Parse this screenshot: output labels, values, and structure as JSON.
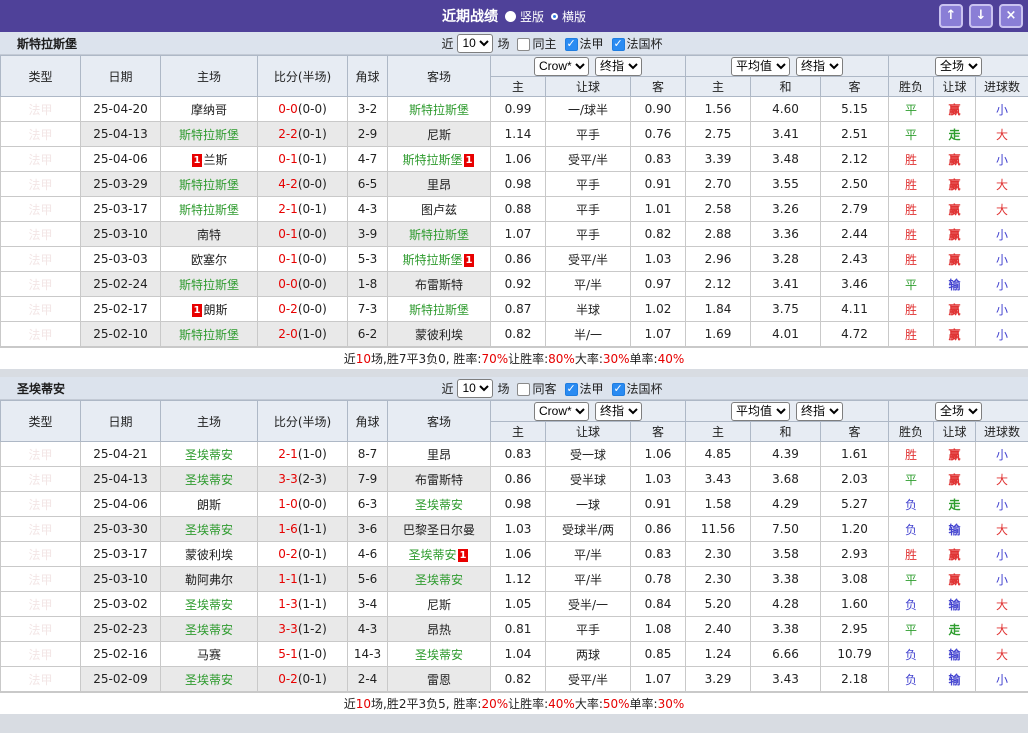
{
  "titlebar": {
    "title": "近期战绩",
    "radios": [
      {
        "label": "竖版",
        "selected": true
      },
      {
        "label": "横版",
        "selected": false
      }
    ],
    "buttons": {
      "up": "↑",
      "down": "↓",
      "close": "×"
    }
  },
  "colors": {
    "titlebar_purple": "#4f4199",
    "league_cell_bg": "#5e3c3c",
    "focus_team_green": "#2e9b2e",
    "score_red": "#e60000",
    "win_red": "#e03333",
    "draw_green": "#2f9e2f",
    "loss_blue": "#4444d0",
    "crow_column_bg": "#fdf6ee",
    "average_column_bg": "#eaf4fa",
    "checkbox_blue": "#2a8bf2"
  },
  "table_header": {
    "main_columns": [
      "类型",
      "日期",
      "主场",
      "比分(半场)",
      "角球",
      "客场"
    ],
    "groups": [
      {
        "selects": [
          "Crow*",
          "终指"
        ],
        "subcols": [
          "主",
          "让球",
          "客"
        ]
      },
      {
        "selects": [
          "平均值",
          "终指"
        ],
        "subcols": [
          "主",
          "和",
          "客"
        ]
      },
      {
        "selects": [
          "全场"
        ],
        "subcols": [
          "胜负",
          "让球",
          "进球数"
        ]
      }
    ]
  },
  "sections": [
    {
      "team": "斯特拉斯堡",
      "filter": {
        "prefix": "近",
        "count": "10",
        "suffix": "场",
        "checkboxes": [
          {
            "label": "同主",
            "checked": false
          },
          {
            "label": "法甲",
            "checked": true
          },
          {
            "label": "法国杯",
            "checked": true
          }
        ]
      },
      "rows": [
        {
          "league": "法甲",
          "date": "25-04-20",
          "home": "摩纳哥",
          "home_focus": false,
          "home_card": "",
          "score": "0-0",
          "half": "(0-0)",
          "corners": "3-2",
          "away": "斯特拉斯堡",
          "away_focus": true,
          "away_card": "",
          "crow": [
            "0.99",
            "一/球半",
            "0.90"
          ],
          "avg": [
            "1.56",
            "4.60",
            "5.15"
          ],
          "results": [
            [
              "平",
              "green"
            ],
            [
              "赢",
              "red"
            ],
            [
              "小",
              "blue"
            ]
          ]
        },
        {
          "league": "法甲",
          "date": "25-04-13",
          "home": "斯特拉斯堡",
          "home_focus": true,
          "home_card": "",
          "score": "2-2",
          "half": "(0-1)",
          "corners": "2-9",
          "away": "尼斯",
          "away_focus": false,
          "away_card": "",
          "crow": [
            "1.14",
            "平手",
            "0.76"
          ],
          "avg": [
            "2.75",
            "3.41",
            "2.51"
          ],
          "results": [
            [
              "平",
              "green"
            ],
            [
              "走",
              "green"
            ],
            [
              "大",
              "red"
            ]
          ]
        },
        {
          "league": "法甲",
          "date": "25-04-06",
          "home": "兰斯",
          "home_focus": false,
          "home_card": "1",
          "score": "0-1",
          "half": "(0-1)",
          "corners": "4-7",
          "away": "斯特拉斯堡",
          "away_focus": true,
          "away_card": "1",
          "crow": [
            "1.06",
            "受平/半",
            "0.83"
          ],
          "avg": [
            "3.39",
            "3.48",
            "2.12"
          ],
          "results": [
            [
              "胜",
              "red"
            ],
            [
              "赢",
              "red"
            ],
            [
              "小",
              "blue"
            ]
          ]
        },
        {
          "league": "法甲",
          "date": "25-03-29",
          "home": "斯特拉斯堡",
          "home_focus": true,
          "home_card": "",
          "score": "4-2",
          "half": "(0-0)",
          "corners": "6-5",
          "away": "里昂",
          "away_focus": false,
          "away_card": "",
          "crow": [
            "0.98",
            "平手",
            "0.91"
          ],
          "avg": [
            "2.70",
            "3.55",
            "2.50"
          ],
          "results": [
            [
              "胜",
              "red"
            ],
            [
              "赢",
              "red"
            ],
            [
              "大",
              "red"
            ]
          ]
        },
        {
          "league": "法甲",
          "date": "25-03-17",
          "home": "斯特拉斯堡",
          "home_focus": true,
          "home_card": "",
          "score": "2-1",
          "half": "(0-1)",
          "corners": "4-3",
          "away": "图卢兹",
          "away_focus": false,
          "away_card": "",
          "crow": [
            "0.88",
            "平手",
            "1.01"
          ],
          "avg": [
            "2.58",
            "3.26",
            "2.79"
          ],
          "results": [
            [
              "胜",
              "red"
            ],
            [
              "赢",
              "red"
            ],
            [
              "大",
              "red"
            ]
          ]
        },
        {
          "league": "法甲",
          "date": "25-03-10",
          "home": "南特",
          "home_focus": false,
          "home_card": "",
          "score": "0-1",
          "half": "(0-0)",
          "corners": "3-9",
          "away": "斯特拉斯堡",
          "away_focus": true,
          "away_card": "",
          "crow": [
            "1.07",
            "平手",
            "0.82"
          ],
          "avg": [
            "2.88",
            "3.36",
            "2.44"
          ],
          "results": [
            [
              "胜",
              "red"
            ],
            [
              "赢",
              "red"
            ],
            [
              "小",
              "blue"
            ]
          ]
        },
        {
          "league": "法甲",
          "date": "25-03-03",
          "home": "欧塞尔",
          "home_focus": false,
          "home_card": "",
          "score": "0-1",
          "half": "(0-0)",
          "corners": "5-3",
          "away": "斯特拉斯堡",
          "away_focus": true,
          "away_card": "1",
          "crow": [
            "0.86",
            "受平/半",
            "1.03"
          ],
          "avg": [
            "2.96",
            "3.28",
            "2.43"
          ],
          "results": [
            [
              "胜",
              "red"
            ],
            [
              "赢",
              "red"
            ],
            [
              "小",
              "blue"
            ]
          ]
        },
        {
          "league": "法甲",
          "date": "25-02-24",
          "home": "斯特拉斯堡",
          "home_focus": true,
          "home_card": "",
          "score": "0-0",
          "half": "(0-0)",
          "corners": "1-8",
          "away": "布雷斯特",
          "away_focus": false,
          "away_card": "",
          "crow": [
            "0.92",
            "平/半",
            "0.97"
          ],
          "avg": [
            "2.12",
            "3.41",
            "3.46"
          ],
          "results": [
            [
              "平",
              "green"
            ],
            [
              "输",
              "blue"
            ],
            [
              "小",
              "blue"
            ]
          ]
        },
        {
          "league": "法甲",
          "date": "25-02-17",
          "home": "朗斯",
          "home_focus": false,
          "home_card": "1",
          "score": "0-2",
          "half": "(0-0)",
          "corners": "7-3",
          "away": "斯特拉斯堡",
          "away_focus": true,
          "away_card": "",
          "crow": [
            "0.87",
            "半球",
            "1.02"
          ],
          "avg": [
            "1.84",
            "3.75",
            "4.11"
          ],
          "results": [
            [
              "胜",
              "red"
            ],
            [
              "赢",
              "red"
            ],
            [
              "小",
              "blue"
            ]
          ]
        },
        {
          "league": "法甲",
          "date": "25-02-10",
          "home": "斯特拉斯堡",
          "home_focus": true,
          "home_card": "",
          "score": "2-0",
          "half": "(1-0)",
          "corners": "6-2",
          "away": "蒙彼利埃",
          "away_focus": false,
          "away_card": "",
          "crow": [
            "0.82",
            "半/一",
            "1.07"
          ],
          "avg": [
            "1.69",
            "4.01",
            "4.72"
          ],
          "results": [
            [
              "胜",
              "red"
            ],
            [
              "赢",
              "red"
            ],
            [
              "小",
              "blue"
            ]
          ]
        }
      ],
      "summary": {
        "segments": [
          [
            "近",
            "dark"
          ],
          [
            "10",
            "red"
          ],
          [
            "场,胜7平3负0, 胜率:",
            "dark"
          ],
          [
            "70%",
            "red"
          ],
          [
            " 让胜率:",
            "dark"
          ],
          [
            "80%",
            "red"
          ],
          [
            " 大率:",
            "dark"
          ],
          [
            "30%",
            "red"
          ],
          [
            " 单率:",
            "dark"
          ],
          [
            "40%",
            "red"
          ]
        ]
      }
    },
    {
      "team": "圣埃蒂安",
      "filter": {
        "prefix": "近",
        "count": "10",
        "suffix": "场",
        "checkboxes": [
          {
            "label": "同客",
            "checked": false
          },
          {
            "label": "法甲",
            "checked": true
          },
          {
            "label": "法国杯",
            "checked": true
          }
        ]
      },
      "rows": [
        {
          "league": "法甲",
          "date": "25-04-21",
          "home": "圣埃蒂安",
          "home_focus": true,
          "home_card": "",
          "score": "2-1",
          "half": "(1-0)",
          "corners": "8-7",
          "away": "里昂",
          "away_focus": false,
          "away_card": "",
          "crow": [
            "0.83",
            "受一球",
            "1.06"
          ],
          "avg": [
            "4.85",
            "4.39",
            "1.61"
          ],
          "results": [
            [
              "胜",
              "red"
            ],
            [
              "赢",
              "red"
            ],
            [
              "小",
              "blue"
            ]
          ]
        },
        {
          "league": "法甲",
          "date": "25-04-13",
          "home": "圣埃蒂安",
          "home_focus": true,
          "home_card": "",
          "score": "3-3",
          "half": "(2-3)",
          "corners": "7-9",
          "away": "布雷斯特",
          "away_focus": false,
          "away_card": "",
          "crow": [
            "0.86",
            "受半球",
            "1.03"
          ],
          "avg": [
            "3.43",
            "3.68",
            "2.03"
          ],
          "results": [
            [
              "平",
              "green"
            ],
            [
              "赢",
              "red"
            ],
            [
              "大",
              "red"
            ]
          ]
        },
        {
          "league": "法甲",
          "date": "25-04-06",
          "home": "朗斯",
          "home_focus": false,
          "home_card": "",
          "score": "1-0",
          "half": "(0-0)",
          "corners": "6-3",
          "away": "圣埃蒂安",
          "away_focus": true,
          "away_card": "",
          "crow": [
            "0.98",
            "一球",
            "0.91"
          ],
          "avg": [
            "1.58",
            "4.29",
            "5.27"
          ],
          "results": [
            [
              "负",
              "blue"
            ],
            [
              "走",
              "green"
            ],
            [
              "小",
              "blue"
            ]
          ]
        },
        {
          "league": "法甲",
          "date": "25-03-30",
          "home": "圣埃蒂安",
          "home_focus": true,
          "home_card": "",
          "score": "1-6",
          "half": "(1-1)",
          "corners": "3-6",
          "away": "巴黎圣日尔曼",
          "away_focus": false,
          "away_card": "",
          "crow": [
            "1.03",
            "受球半/两",
            "0.86"
          ],
          "avg": [
            "11.56",
            "7.50",
            "1.20"
          ],
          "results": [
            [
              "负",
              "blue"
            ],
            [
              "输",
              "blue"
            ],
            [
              "大",
              "red"
            ]
          ]
        },
        {
          "league": "法甲",
          "date": "25-03-17",
          "home": "蒙彼利埃",
          "home_focus": false,
          "home_card": "",
          "score": "0-2",
          "half": "(0-1)",
          "corners": "4-6",
          "away": "圣埃蒂安",
          "away_focus": true,
          "away_card": "1",
          "crow": [
            "1.06",
            "平/半",
            "0.83"
          ],
          "avg": [
            "2.30",
            "3.58",
            "2.93"
          ],
          "results": [
            [
              "胜",
              "red"
            ],
            [
              "赢",
              "red"
            ],
            [
              "小",
              "blue"
            ]
          ]
        },
        {
          "league": "法甲",
          "date": "25-03-10",
          "home": "勒阿弗尔",
          "home_focus": false,
          "home_card": "",
          "score": "1-1",
          "half": "(1-1)",
          "corners": "5-6",
          "away": "圣埃蒂安",
          "away_focus": true,
          "away_card": "",
          "crow": [
            "1.12",
            "平/半",
            "0.78"
          ],
          "avg": [
            "2.30",
            "3.38",
            "3.08"
          ],
          "results": [
            [
              "平",
              "green"
            ],
            [
              "赢",
              "red"
            ],
            [
              "小",
              "blue"
            ]
          ]
        },
        {
          "league": "法甲",
          "date": "25-03-02",
          "home": "圣埃蒂安",
          "home_focus": true,
          "home_card": "",
          "score": "1-3",
          "half": "(1-1)",
          "corners": "3-4",
          "away": "尼斯",
          "away_focus": false,
          "away_card": "",
          "crow": [
            "1.05",
            "受半/一",
            "0.84"
          ],
          "avg": [
            "5.20",
            "4.28",
            "1.60"
          ],
          "results": [
            [
              "负",
              "blue"
            ],
            [
              "输",
              "blue"
            ],
            [
              "大",
              "red"
            ]
          ]
        },
        {
          "league": "法甲",
          "date": "25-02-23",
          "home": "圣埃蒂安",
          "home_focus": true,
          "home_card": "",
          "score": "3-3",
          "half": "(1-2)",
          "corners": "4-3",
          "away": "昂热",
          "away_focus": false,
          "away_card": "",
          "crow": [
            "0.81",
            "平手",
            "1.08"
          ],
          "avg": [
            "2.40",
            "3.38",
            "2.95"
          ],
          "results": [
            [
              "平",
              "green"
            ],
            [
              "走",
              "green"
            ],
            [
              "大",
              "red"
            ]
          ]
        },
        {
          "league": "法甲",
          "date": "25-02-16",
          "home": "马赛",
          "home_focus": false,
          "home_card": "",
          "score": "5-1",
          "half": "(1-0)",
          "corners": "14-3",
          "away": "圣埃蒂安",
          "away_focus": true,
          "away_card": "",
          "crow": [
            "1.04",
            "两球",
            "0.85"
          ],
          "avg": [
            "1.24",
            "6.66",
            "10.79"
          ],
          "results": [
            [
              "负",
              "blue"
            ],
            [
              "输",
              "blue"
            ],
            [
              "大",
              "red"
            ]
          ]
        },
        {
          "league": "法甲",
          "date": "25-02-09",
          "home": "圣埃蒂安",
          "home_focus": true,
          "home_card": "",
          "score": "0-2",
          "half": "(0-1)",
          "corners": "2-4",
          "away": "雷恩",
          "away_focus": false,
          "away_card": "",
          "crow": [
            "0.82",
            "受平/半",
            "1.07"
          ],
          "avg": [
            "3.29",
            "3.43",
            "2.18"
          ],
          "results": [
            [
              "负",
              "blue"
            ],
            [
              "输",
              "blue"
            ],
            [
              "小",
              "blue"
            ]
          ]
        }
      ],
      "summary": {
        "segments": [
          [
            "近",
            "dark"
          ],
          [
            "10",
            "red"
          ],
          [
            "场,胜2平3负5, 胜率:",
            "dark"
          ],
          [
            "20%",
            "red"
          ],
          [
            " 让胜率:",
            "dark"
          ],
          [
            "40%",
            "red"
          ],
          [
            " 大率:",
            "dark"
          ],
          [
            "50%",
            "red"
          ],
          [
            " 单率:",
            "dark"
          ],
          [
            "30%",
            "red"
          ]
        ]
      }
    }
  ]
}
